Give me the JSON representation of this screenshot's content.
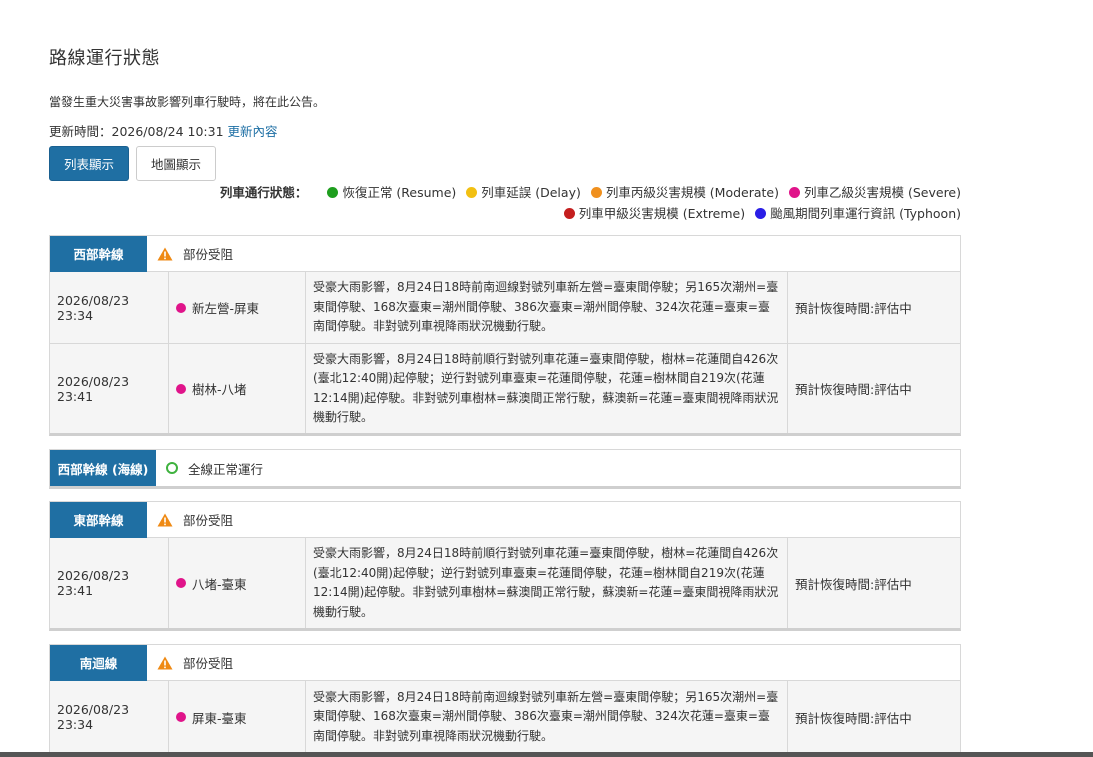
{
  "title": "路線運行狀態",
  "notice": "當發生重大災害事故影響列車行駛時，將在此公告。",
  "update": {
    "label": "更新時間：2026/08/24 10:31",
    "link": "更新內容"
  },
  "buttons": {
    "list": "列表顯示",
    "map": "地圖顯示"
  },
  "legend": {
    "label": "列車通行狀態：",
    "items": [
      {
        "text": "恢復正常 (Resume)",
        "color": "#1e9e1e"
      },
      {
        "text": "列車延誤 (Delay)",
        "color": "#f2c012"
      },
      {
        "text": "列車丙級災害規模 (Moderate)",
        "color": "#f0901e"
      },
      {
        "text": "列車乙級災害規模 (Severe)",
        "color": "#e0148a"
      },
      {
        "text": "列車甲級災害規模 (Extreme)",
        "color": "#c41e1e"
      },
      {
        "text": "颱風期間列車運行資訊 (Typhoon)",
        "color": "#2a1ee6"
      }
    ]
  },
  "sections": [
    {
      "name": "西部幹線",
      "status": "部份受阻",
      "rows": [
        {
          "time": "2026/08/23 23:34",
          "segment": "新左營-屏東",
          "desc": "受豪大雨影響，8月24日18時前南迴線對號列車新左營=臺東間停駛；另165次潮州=臺東間停駛、168次臺東=潮州間停駛、386次臺東=潮州間停駛、324次花蓮=臺東=臺南間停駛。非對號列車視降雨狀況機動行駛。",
          "estimate": "預計恢復時間:評估中"
        },
        {
          "time": "2026/08/23 23:41",
          "segment": "樹林-八堵",
          "desc": "受豪大雨影響，8月24日18時前順行對號列車花蓮=臺東間停駛，樹林=花蓮間自426次(臺北12:40開)起停駛；逆行對號列車臺東=花蓮間停駛，花蓮=樹林間自219次(花蓮12:14開)起停駛。非對號列車樹林=蘇澳間正常行駛，蘇澳新=花蓮=臺東間視降雨狀況機動行駛。",
          "estimate": "預計恢復時間:評估中"
        }
      ]
    },
    {
      "name": "西部幹線 (海線)",
      "status": "全線正常運行",
      "rows": []
    },
    {
      "name": "東部幹線",
      "status": "部份受阻",
      "rows": [
        {
          "time": "2026/08/23 23:41",
          "segment": "八堵-臺東",
          "desc": "受豪大雨影響，8月24日18時前順行對號列車花蓮=臺東間停駛，樹林=花蓮間自426次(臺北12:40開)起停駛；逆行對號列車臺東=花蓮間停駛，花蓮=樹林間自219次(花蓮12:14開)起停駛。非對號列車樹林=蘇澳間正常行駛，蘇澳新=花蓮=臺東間視降雨狀況機動行駛。",
          "estimate": "預計恢復時間:評估中"
        }
      ]
    },
    {
      "name": "南迴線",
      "status": "部份受阻",
      "rows": [
        {
          "time": "2026/08/23 23:34",
          "segment": "屏東-臺東",
          "desc": "受豪大雨影響，8月24日18時前南迴線對號列車新左營=臺東間停駛；另165次潮州=臺東間停駛、168次臺東=潮州間停駛、386次臺東=潮州間停駛、324次花蓮=臺東=臺南間停駛。非對號列車視降雨狀況機動行駛。",
          "estimate": "預計恢復時間:評估中"
        }
      ]
    }
  ]
}
